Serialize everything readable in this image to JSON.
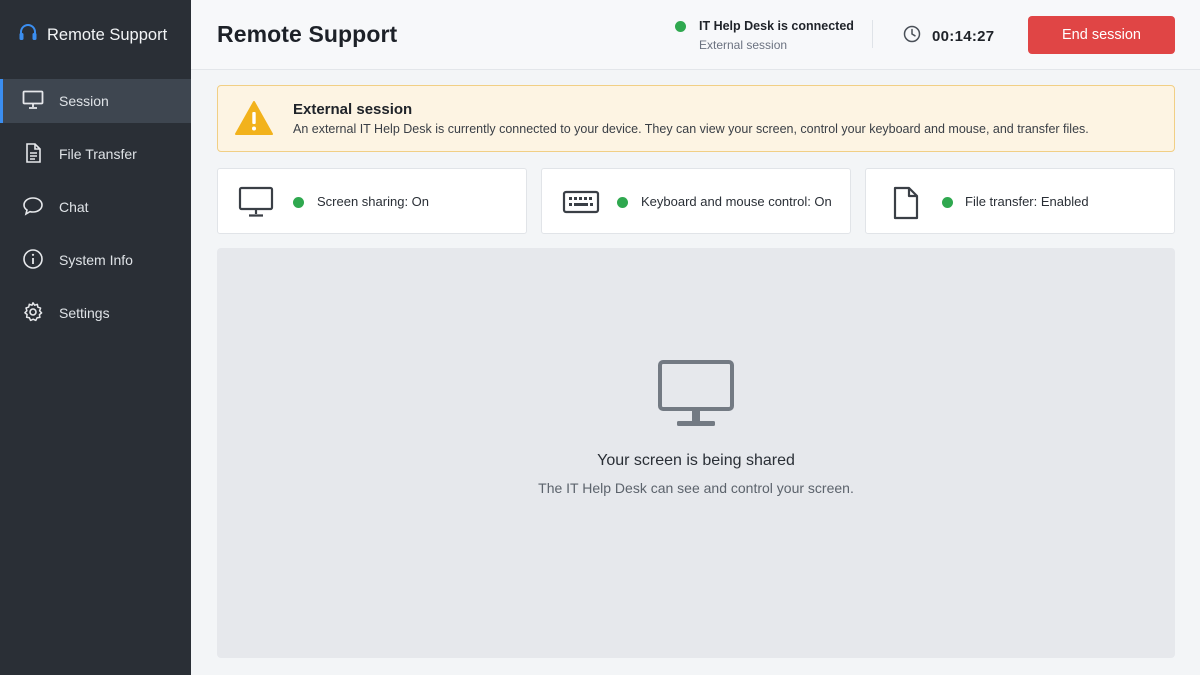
{
  "sidebar": {
    "brand": "Remote Support",
    "items": [
      {
        "label": "Session",
        "icon": "monitor-icon",
        "active": true
      },
      {
        "label": "File Transfer",
        "icon": "document-icon",
        "active": false
      },
      {
        "label": "Chat",
        "icon": "chat-bubble-icon",
        "active": false
      },
      {
        "label": "System Info",
        "icon": "info-icon",
        "active": false
      },
      {
        "label": "Settings",
        "icon": "gear-icon",
        "active": false
      }
    ]
  },
  "header": {
    "title": "Remote Support",
    "connection_title": "IT Help Desk is connected",
    "connection_subtitle": "External session",
    "timer": "00:14:27",
    "end_button": "End session"
  },
  "alert": {
    "title": "External session",
    "message": "An external IT Help Desk is currently connected to your device. They can view your screen, control your keyboard and mouse, and transfer files."
  },
  "status_cards": [
    {
      "label": "Screen sharing: On",
      "icon": "monitor-icon"
    },
    {
      "label": "Keyboard and mouse control: On",
      "icon": "keyboard-icon"
    },
    {
      "label": "File transfer: Enabled",
      "icon": "file-icon"
    }
  ],
  "share_panel": {
    "title": "Your screen is being shared",
    "subtitle": "The IT Help Desk can see and control your screen."
  },
  "colors": {
    "sidebar_bg": "#2a2f36",
    "active_item_bg": "#3e4650",
    "accent_blue": "#3b8ef0",
    "status_green": "#2fa84f",
    "danger_red": "#e04545",
    "warning_yellow": "#f2b21c"
  }
}
